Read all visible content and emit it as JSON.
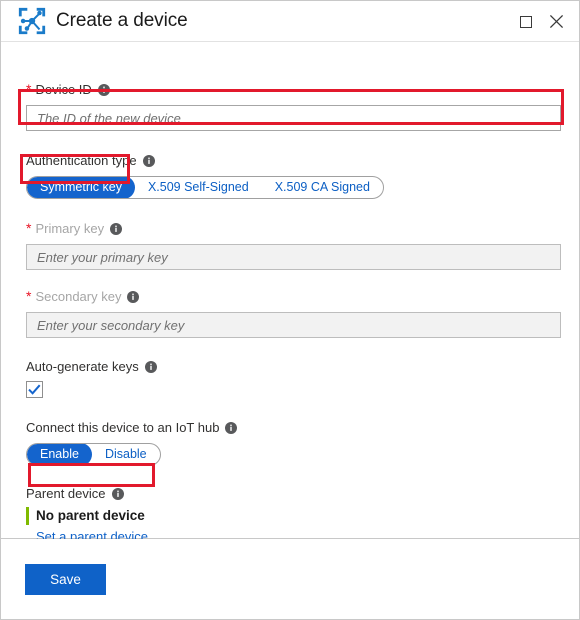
{
  "window": {
    "title": "Create a device",
    "app_icon": "iot-device-icon",
    "controls": {
      "maximize": "maximize-icon",
      "close": "close-icon"
    }
  },
  "form": {
    "device_id": {
      "label": "Device ID",
      "required_marker": "*",
      "info": "info-icon",
      "value": "",
      "placeholder": "The ID of the new device"
    },
    "auth_type": {
      "label": "Authentication type",
      "info": "info-icon",
      "options": [
        {
          "label": "Symmetric key",
          "selected": true
        },
        {
          "label": "X.509 Self-Signed",
          "selected": false
        },
        {
          "label": "X.509 CA Signed",
          "selected": false
        }
      ]
    },
    "primary_key": {
      "label": "Primary key",
      "required_marker": "*",
      "info": "info-icon",
      "value": "",
      "placeholder": "Enter your primary key",
      "disabled": true
    },
    "secondary_key": {
      "label": "Secondary key",
      "required_marker": "*",
      "info": "info-icon",
      "value": "",
      "placeholder": "Enter your secondary key",
      "disabled": true
    },
    "auto_generate_keys": {
      "label": "Auto-generate keys",
      "info": "info-icon",
      "checked": true
    },
    "connect_hub": {
      "label": "Connect this device to an IoT hub",
      "info": "info-icon",
      "options": [
        {
          "label": "Enable",
          "selected": true
        },
        {
          "label": "Disable",
          "selected": false
        }
      ]
    },
    "parent_device": {
      "label": "Parent device",
      "info": "info-icon",
      "value": "No parent device",
      "link": "Set a parent device"
    }
  },
  "footer": {
    "save_label": "Save"
  },
  "colors": {
    "accent_blue": "#0f62c8",
    "selected_pill": "#1464cd",
    "required_red": "#e81123",
    "annotation_red": "#e2192c",
    "parent_green": "#7fba00"
  }
}
